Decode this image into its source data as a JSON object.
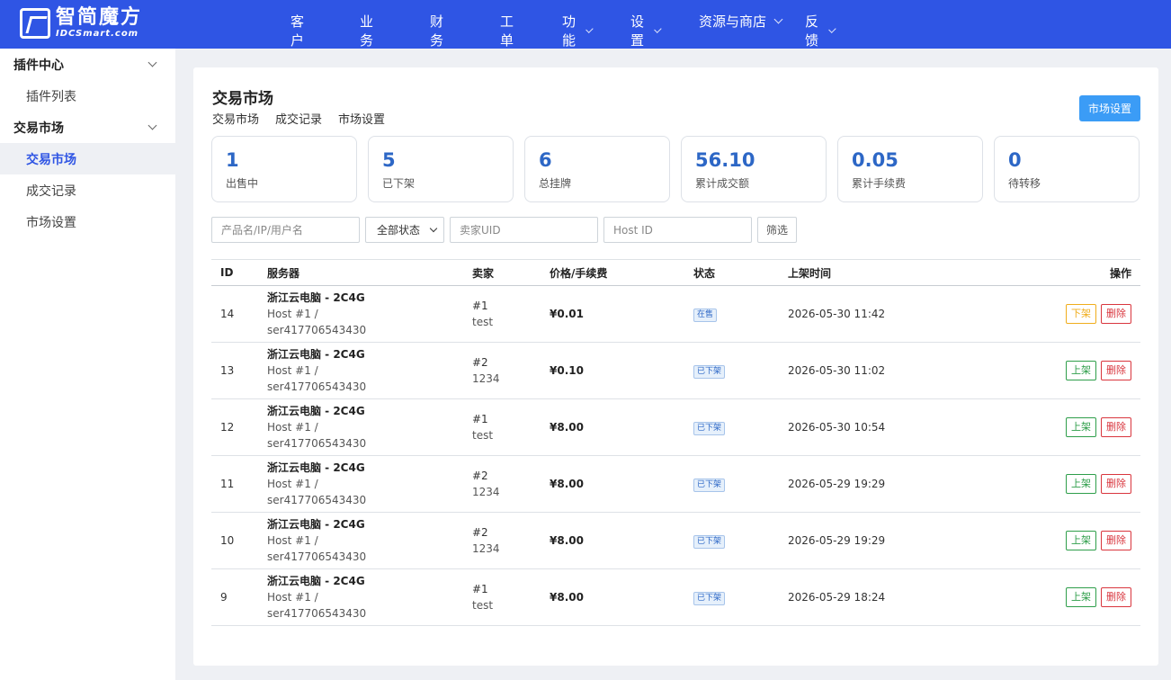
{
  "brand": {
    "name_cn": "智简魔方",
    "name_en": "IDCSmart.com"
  },
  "nav": [
    {
      "label": "客户",
      "dropdown": false
    },
    {
      "label": "业务",
      "dropdown": false
    },
    {
      "label": "财务",
      "dropdown": false
    },
    {
      "label": "工单",
      "dropdown": false
    },
    {
      "label": "功能",
      "dropdown": true
    },
    {
      "label": "设置",
      "dropdown": true
    },
    {
      "label": "资源与商店",
      "dropdown": true
    },
    {
      "label": "反馈",
      "dropdown": true
    }
  ],
  "sidebar": {
    "groups": [
      {
        "label": "插件中心",
        "items": [
          {
            "label": "插件列表",
            "active": false
          }
        ]
      },
      {
        "label": "交易市场",
        "items": [
          {
            "label": "交易市场",
            "active": true
          },
          {
            "label": "成交记录",
            "active": false
          },
          {
            "label": "市场设置",
            "active": false
          }
        ]
      }
    ]
  },
  "page": {
    "title": "交易市场",
    "subtabs": [
      "交易市场",
      "成交记录",
      "市场设置"
    ],
    "settings_button": "市场设置"
  },
  "stats": [
    {
      "value": "1",
      "label": "出售中"
    },
    {
      "value": "5",
      "label": "已下架"
    },
    {
      "value": "6",
      "label": "总挂牌"
    },
    {
      "value": "56.10",
      "label": "累计成交额"
    },
    {
      "value": "0.05",
      "label": "累计手续费"
    },
    {
      "value": "0",
      "label": "待转移"
    }
  ],
  "filters": {
    "keyword_placeholder": "产品名/IP/用户名",
    "status_selected": "全部状态",
    "seller_placeholder": "卖家UID",
    "host_placeholder": "Host ID",
    "submit_label": "筛选"
  },
  "table": {
    "headers": {
      "id": "ID",
      "server": "服务器",
      "seller": "卖家",
      "price": "价格/手续费",
      "status": "状态",
      "time": "上架时间",
      "ops": "操作"
    },
    "rows": [
      {
        "id": "14",
        "server_name": "浙江云电脑 - 2C4G",
        "host": "Host #1 /",
        "server_code": "ser417706543430",
        "seller_id": "#1",
        "seller_name": "test",
        "price": "¥0.01",
        "status": "在售",
        "time": "2026-05-30 11:42",
        "action": "下架",
        "action_type": "down",
        "delete": "删除"
      },
      {
        "id": "13",
        "server_name": "浙江云电脑 - 2C4G",
        "host": "Host #1 /",
        "server_code": "ser417706543430",
        "seller_id": "#2",
        "seller_name": "1234",
        "price": "¥0.10",
        "status": "已下架",
        "time": "2026-05-30 11:02",
        "action": "上架",
        "action_type": "up",
        "delete": "删除"
      },
      {
        "id": "12",
        "server_name": "浙江云电脑 - 2C4G",
        "host": "Host #1 /",
        "server_code": "ser417706543430",
        "seller_id": "#1",
        "seller_name": "test",
        "price": "¥8.00",
        "status": "已下架",
        "time": "2026-05-30 10:54",
        "action": "上架",
        "action_type": "up",
        "delete": "删除"
      },
      {
        "id": "11",
        "server_name": "浙江云电脑 - 2C4G",
        "host": "Host #1 /",
        "server_code": "ser417706543430",
        "seller_id": "#2",
        "seller_name": "1234",
        "price": "¥8.00",
        "status": "已下架",
        "time": "2026-05-29 19:29",
        "action": "上架",
        "action_type": "up",
        "delete": "删除"
      },
      {
        "id": "10",
        "server_name": "浙江云电脑 - 2C4G",
        "host": "Host #1 /",
        "server_code": "ser417706543430",
        "seller_id": "#2",
        "seller_name": "1234",
        "price": "¥8.00",
        "status": "已下架",
        "time": "2026-05-29 19:29",
        "action": "上架",
        "action_type": "up",
        "delete": "删除"
      },
      {
        "id": "9",
        "server_name": "浙江云电脑 - 2C4G",
        "host": "Host #1 /",
        "server_code": "ser417706543430",
        "seller_id": "#1",
        "seller_name": "test",
        "price": "¥8.00",
        "status": "已下架",
        "time": "2026-05-29 18:24",
        "action": "上架",
        "action_type": "up",
        "delete": "删除"
      }
    ]
  },
  "colors": {
    "header_bg": "#2f55e4",
    "accent": "#2d67c6",
    "primary_button": "#3b9cf6",
    "take_down": "#f0ad1c",
    "put_up": "#2e9e4a",
    "delete": "#d9363e"
  }
}
